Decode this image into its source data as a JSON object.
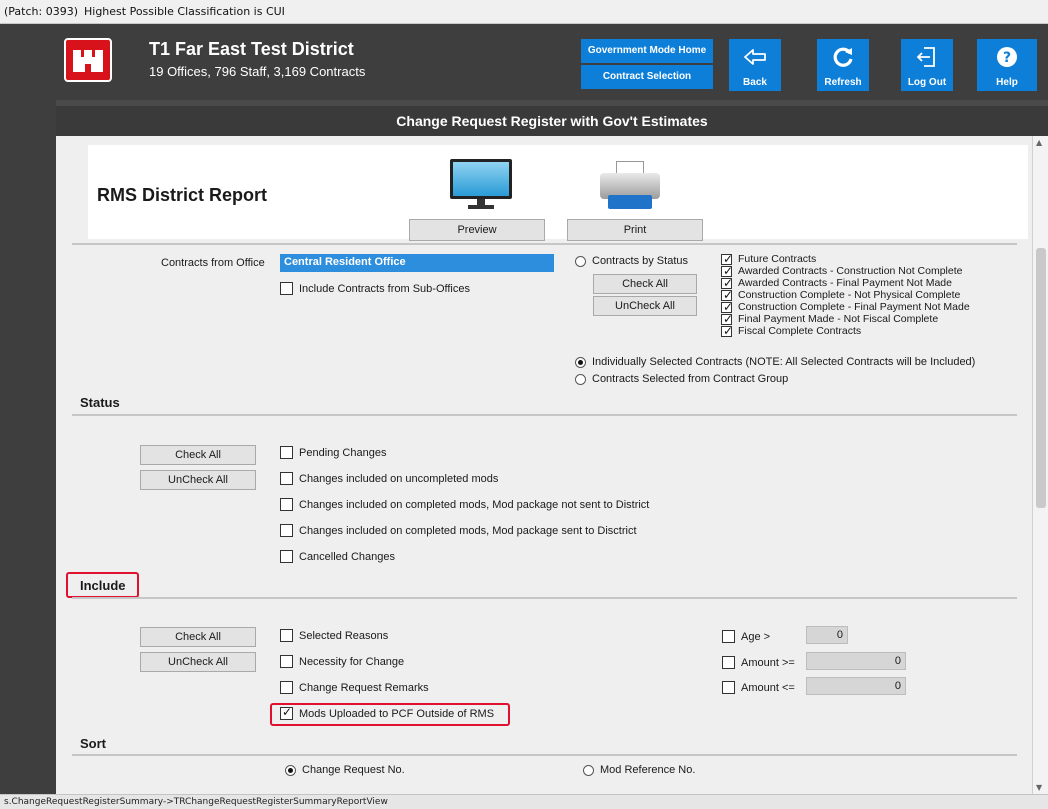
{
  "topbar": {
    "patch": "(Patch: 0393)",
    "classification": "Highest Possible Classification is CUI"
  },
  "header": {
    "title": "T1 Far East Test District",
    "subtitle": "19 Offices, 796 Staff, 3,169 Contracts",
    "gov_mode_home": "Government Mode Home",
    "contract_selection": "Contract Selection",
    "back": "Back",
    "refresh": "Refresh",
    "log_out": "Log Out",
    "help": "Help"
  },
  "page_title": "Change Request Register with Gov't Estimates",
  "report": {
    "title": "RMS District Report",
    "preview": "Preview",
    "print": "Print"
  },
  "contracts": {
    "from_office_label": "Contracts from Office",
    "office_value": "Central Resident Office",
    "include_sub_offices": "Include Contracts from Sub-Offices",
    "by_status": "Contracts by Status",
    "check_all": "Check All",
    "uncheck_all": "UnCheck All",
    "status_options": [
      {
        "label": "Future Contracts",
        "checked": true
      },
      {
        "label": "Awarded Contracts - Construction Not Complete",
        "checked": true
      },
      {
        "label": "Awarded Contracts - Final Payment Not Made",
        "checked": true
      },
      {
        "label": "Construction Complete - Not Physical Complete",
        "checked": true
      },
      {
        "label": "Construction Complete - Final Payment Not Made",
        "checked": true
      },
      {
        "label": "Final Payment Made - Not Fiscal Complete",
        "checked": true
      },
      {
        "label": "Fiscal Complete Contracts",
        "checked": true
      }
    ],
    "individually_selected": "Individually Selected Contracts (NOTE: All Selected Contracts will be Included)",
    "from_group": "Contracts Selected from Contract Group",
    "selected_mode": "individually_selected"
  },
  "status": {
    "heading": "Status",
    "check_all": "Check All",
    "uncheck_all": "UnCheck All",
    "options": [
      {
        "label": "Pending Changes",
        "checked": false
      },
      {
        "label": "Changes included on uncompleted mods",
        "checked": false
      },
      {
        "label": "Changes included on completed mods, Mod package not sent to District",
        "checked": false
      },
      {
        "label": "Changes included on completed mods, Mod package sent to Disctrict",
        "checked": false
      },
      {
        "label": "Cancelled Changes",
        "checked": false
      }
    ]
  },
  "include": {
    "heading": "Include",
    "check_all": "Check All",
    "uncheck_all": "UnCheck All",
    "options": [
      {
        "label": "Selected Reasons",
        "checked": false
      },
      {
        "label": "Necessity for Change",
        "checked": false
      },
      {
        "label": "Change Request Remarks",
        "checked": false
      },
      {
        "label": "Mods Uploaded to PCF Outside of RMS",
        "checked": true
      }
    ],
    "age_label": "Age >",
    "age_value": "0",
    "amount_ge_label": "Amount >=",
    "amount_ge_value": "0",
    "amount_le_label": "Amount <=",
    "amount_le_value": "0"
  },
  "sort": {
    "heading": "Sort",
    "change_request_no": "Change Request No.",
    "mod_reference_no": "Mod Reference No.",
    "selected": "change_request_no"
  },
  "statusbar": "s.ChangeRequestRegisterSummary->TRChangeRequestRegisterSummaryReportView"
}
